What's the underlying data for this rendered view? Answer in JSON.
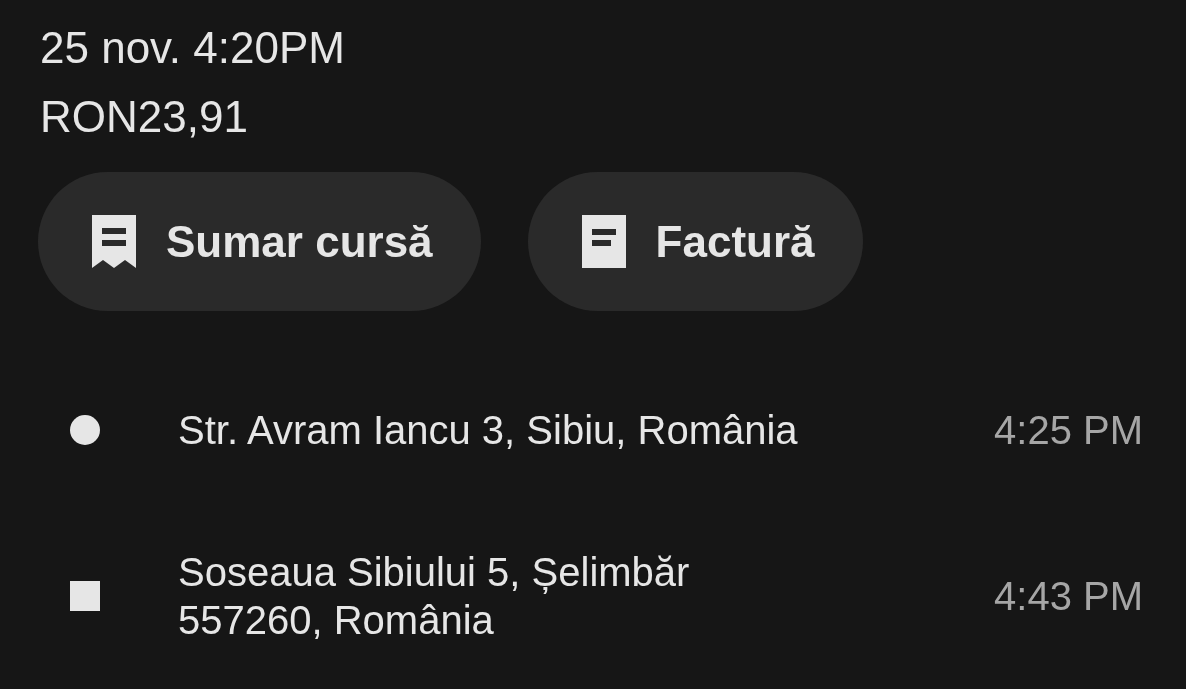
{
  "trip": {
    "date_time": "25 nov. 4:20PM",
    "price": "RON23,91"
  },
  "actions": [
    {
      "kind": "receipt",
      "label": "Sumar cursă"
    },
    {
      "kind": "document",
      "label": "Factură"
    }
  ],
  "stops": [
    {
      "kind": "pickup",
      "address": "Str. Avram Iancu 3, Sibiu, România",
      "time": "4:25 PM"
    },
    {
      "kind": "dropoff",
      "address": "Soseaua Sibiului 5, Șelimbăr 557260, România",
      "time": "4:43 PM"
    }
  ]
}
